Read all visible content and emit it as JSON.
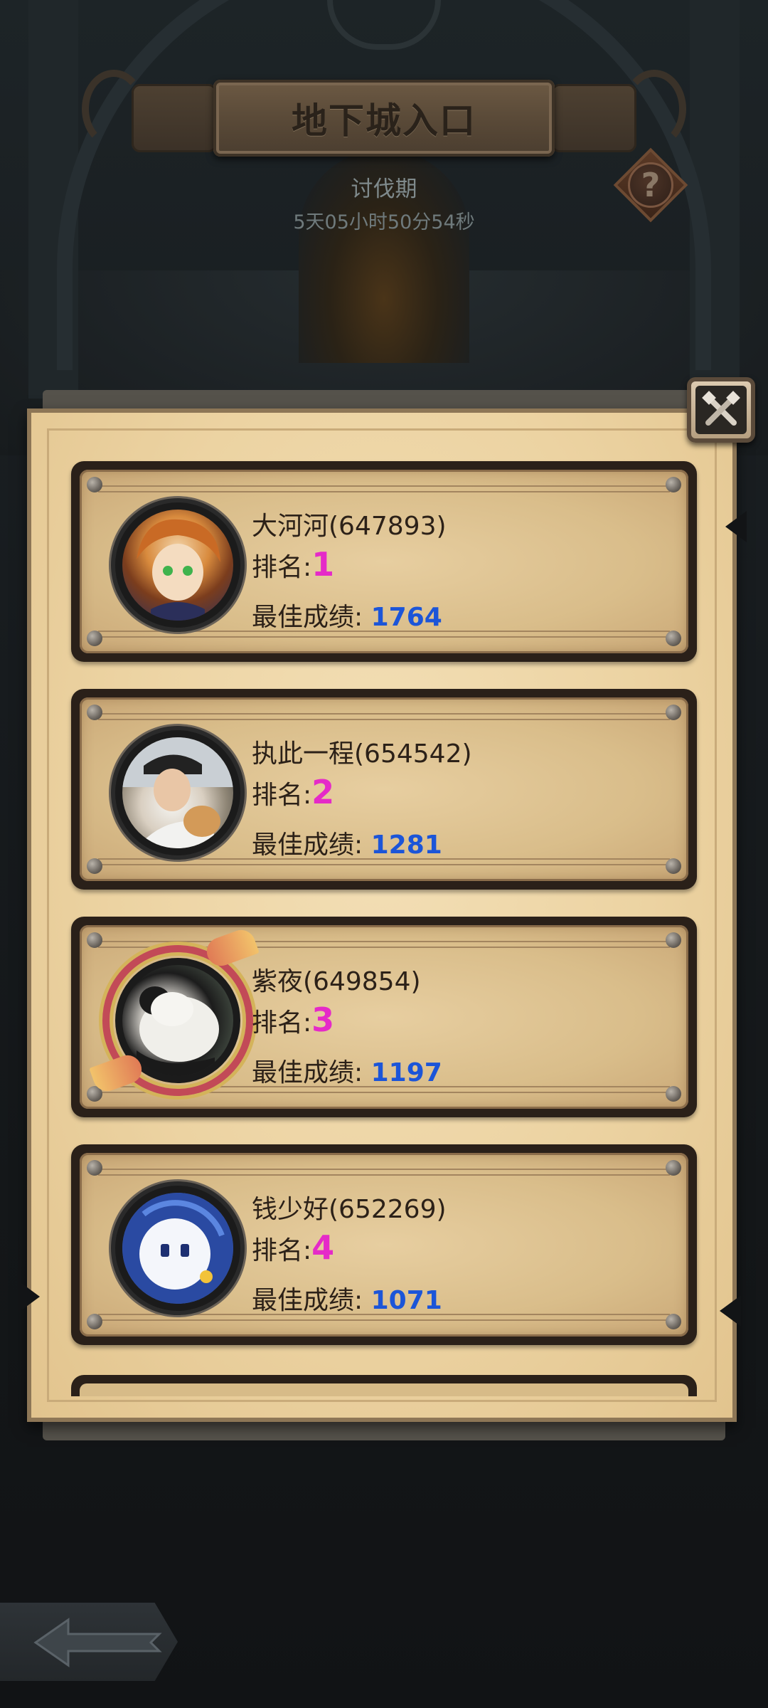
{
  "header": {
    "title": "地下城入口",
    "period_label": "讨伐期",
    "countdown": "5天05小时50分54秒",
    "help_glyph": "?"
  },
  "icons": {
    "help": "help-question-icon",
    "close": "close-crossed-tools-icon",
    "back": "back-arrow-icon"
  },
  "labels": {
    "rank_prefix": "排名:",
    "score_prefix": "最佳成绩:"
  },
  "colors": {
    "rank_number": "#e52ac8",
    "score_number": "#1c55d8"
  },
  "ranking": [
    {
      "name": "大河河(647893)",
      "rank": "1",
      "score": "1764"
    },
    {
      "name": "执此一程(654542)",
      "rank": "2",
      "score": "1281"
    },
    {
      "name": "紫夜(649854)",
      "rank": "3",
      "score": "1197"
    },
    {
      "name": "钱少好(652269)",
      "rank": "4",
      "score": "1071"
    }
  ]
}
